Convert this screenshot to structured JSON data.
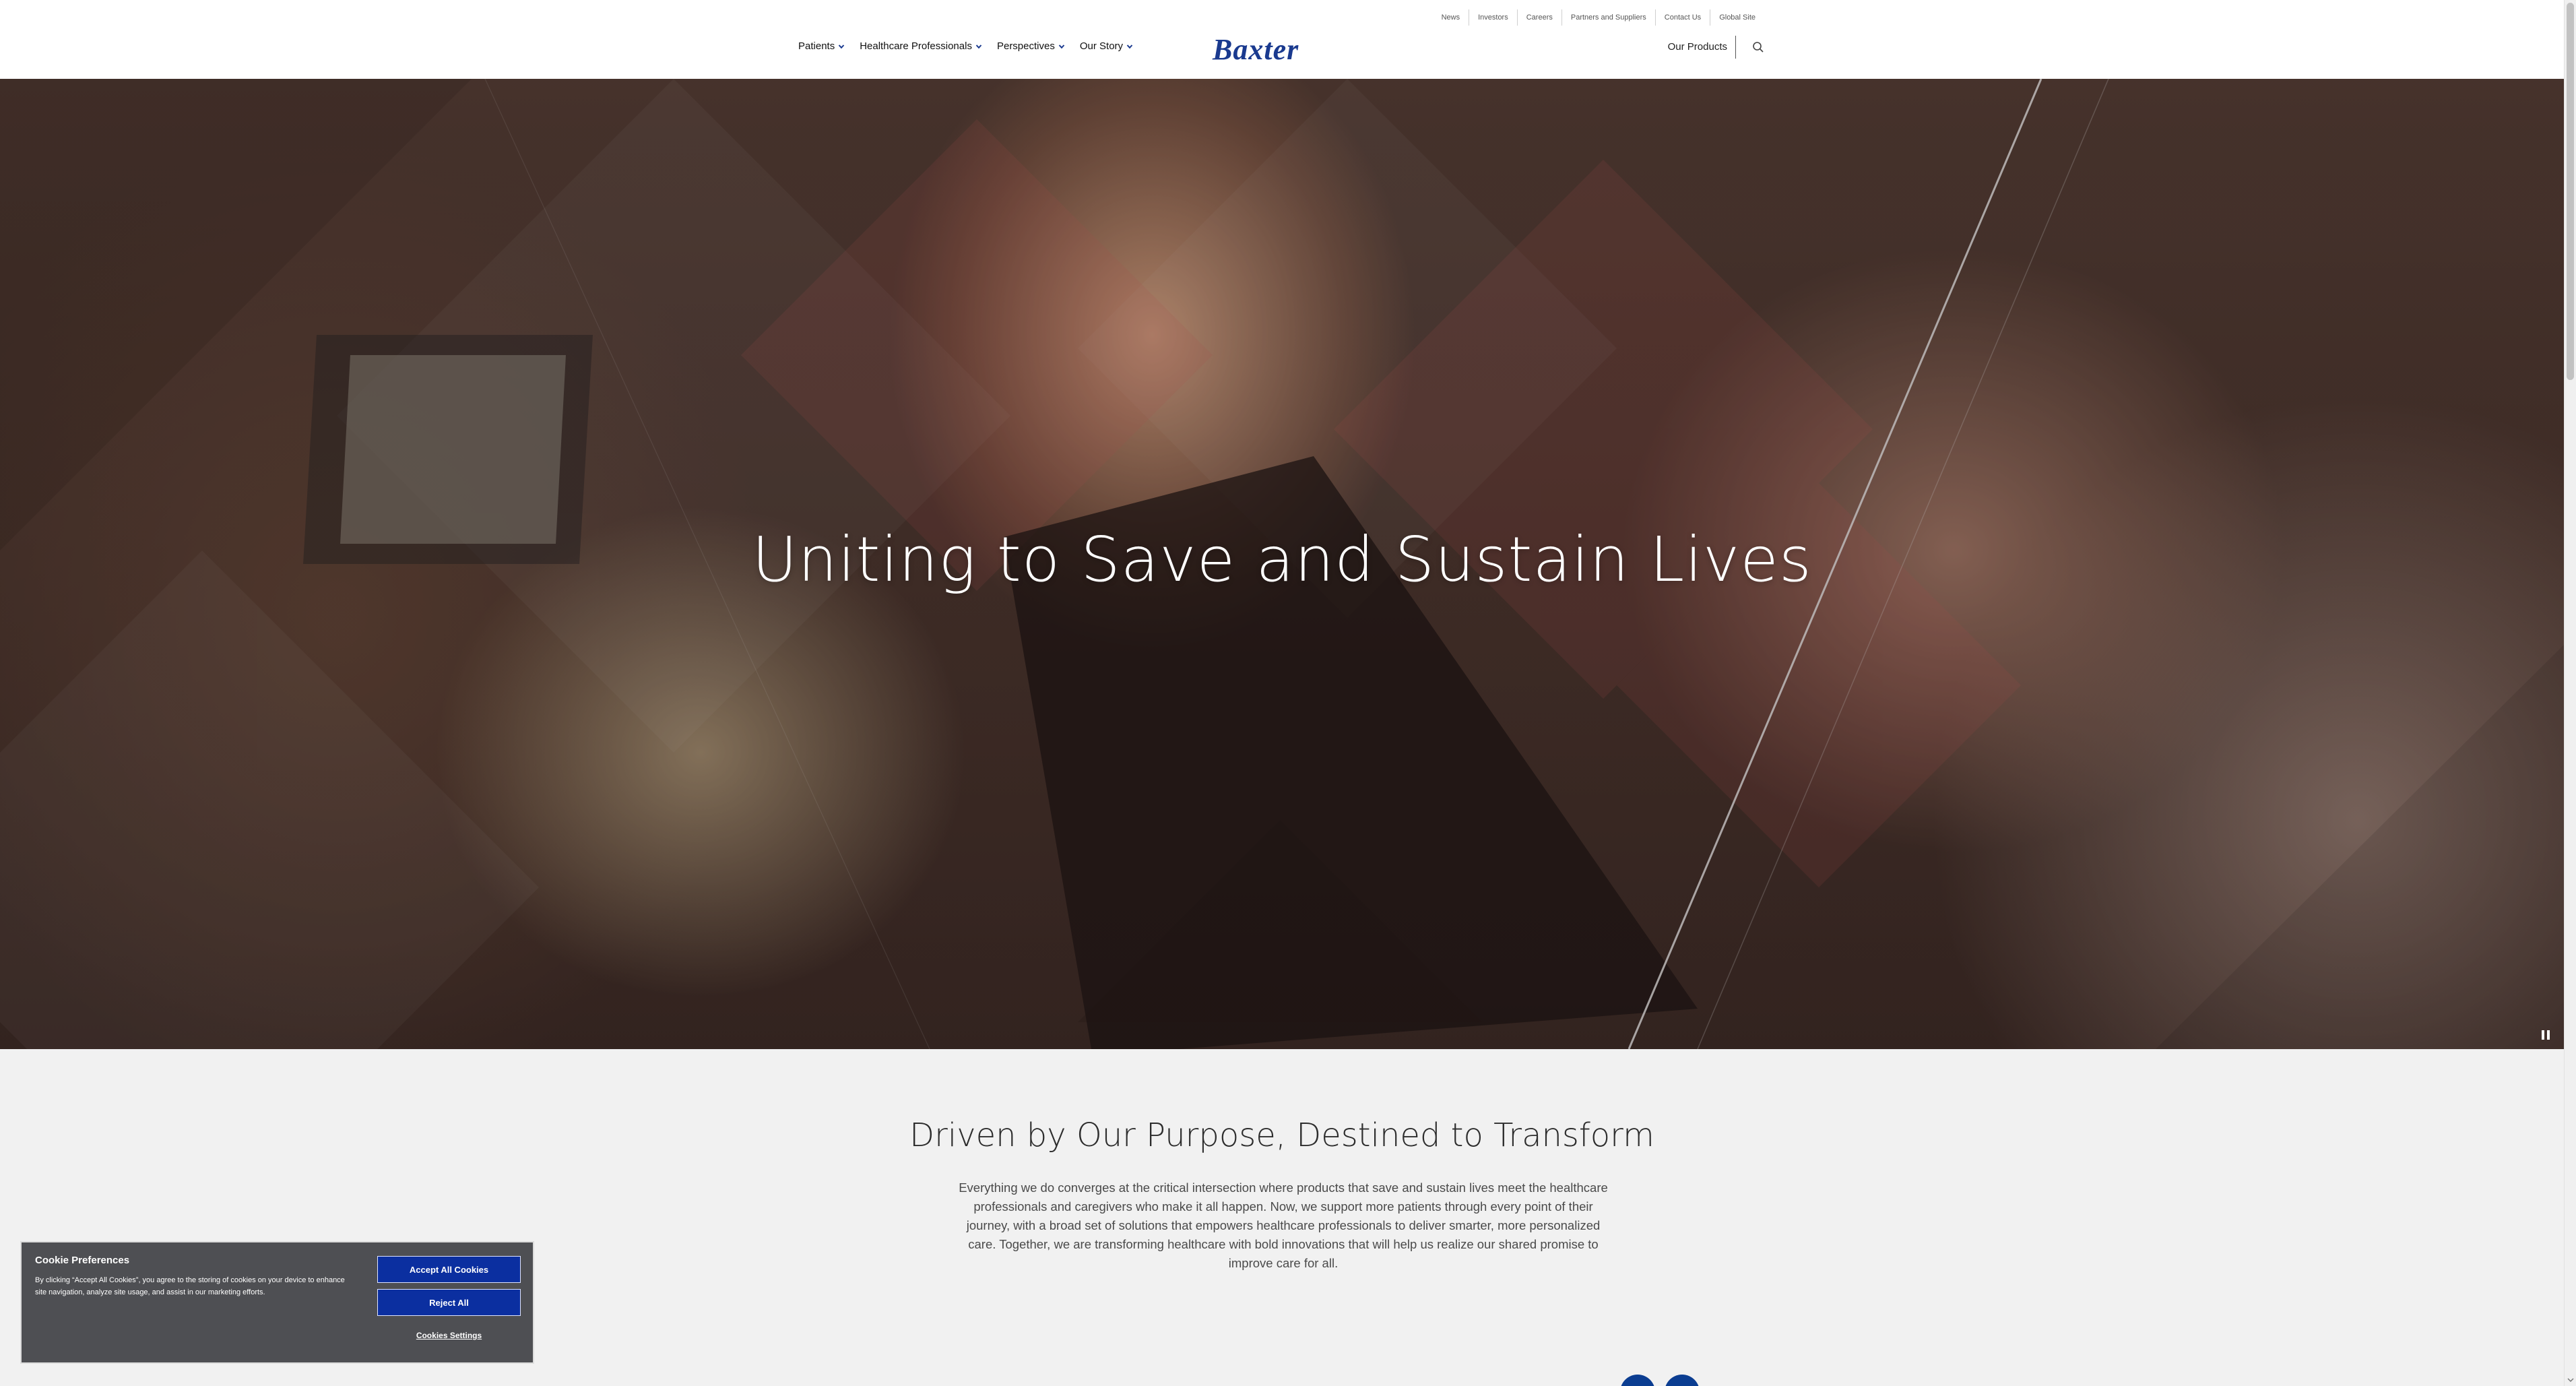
{
  "header": {
    "utility_links": [
      "News",
      "Investors",
      "Careers",
      "Partners and Suppliers",
      "Contact Us",
      "Global Site"
    ],
    "nav_items": [
      "Patients",
      "Healthcare Professionals",
      "Perspectives",
      "Our Story"
    ],
    "logo_text": "Baxter",
    "our_products": "Our Products"
  },
  "hero": {
    "title": "Uniting to Save and Sustain Lives"
  },
  "purpose": {
    "heading": "Driven by Our Purpose, Destined to Transform",
    "body": "Everything we do converges at the critical intersection where products that save and sustain lives meet the healthcare professionals and caregivers who make it all happen. Now, we support more patients through every point of their journey, with a broad set of solutions that empowers healthcare professionals to deliver smarter, more personalized care. Together, we are transforming healthcare with bold innovations that will help us realize our shared promise to improve care for all."
  },
  "cookie_banner": {
    "title": "Cookie Preferences",
    "description": "By clicking “Accept All Cookies”, you agree to the storing of cookies on your device to enhance site navigation, analyze site usage, and assist in our marketing efforts.",
    "accept_label": "Accept All Cookies",
    "reject_label": "Reject All",
    "settings_label": "Cookies Settings"
  },
  "colors": {
    "brand_blue": "#1a3a8f",
    "button_blue": "#0b2fa0",
    "cookie_bg": "#4e4f53"
  },
  "icons": {
    "nav_chevron": "chevron-down-icon",
    "search": "search-icon",
    "pause": "pause-icon"
  }
}
